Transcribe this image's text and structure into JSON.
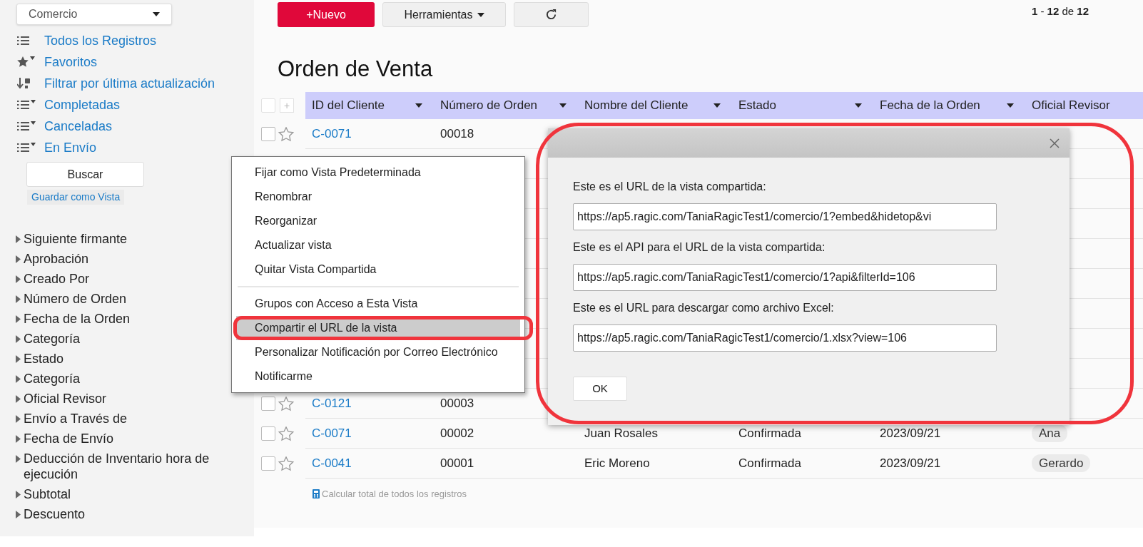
{
  "sidebar": {
    "sheet_select": {
      "value": "Comercio"
    },
    "views": [
      {
        "label": "Todos los Registros",
        "kind": "list"
      },
      {
        "label": "Favoritos",
        "kind": "star"
      },
      {
        "label": "Filtrar por última actualización",
        "kind": "sort"
      },
      {
        "label": "Completadas",
        "kind": "filter"
      },
      {
        "label": "Canceladas",
        "kind": "filter"
      },
      {
        "label": "En Envío",
        "kind": "filter"
      }
    ],
    "search_button": "Buscar",
    "save_view_link": "Guardar como Vista",
    "fields": [
      "Siguiente firmante",
      "Aprobación",
      "Creado Por",
      "Número de Orden",
      "Fecha de la Orden",
      "Categoría",
      "Estado",
      "Categoría",
      "Oficial Revisor",
      "Envío a Través de",
      "Fecha de Envío",
      "Deducción de Inventario hora de ejecución",
      "Subtotal",
      "Descuento"
    ]
  },
  "toolbar": {
    "new_button": "+Nuevo",
    "tools_button": "Herramientas",
    "pagination": "**1** - **12** de **12**"
  },
  "title": "Orden de Venta",
  "table": {
    "columns": [
      "ID del Cliente",
      "Número de Orden",
      "Nombre del Cliente",
      "Estado",
      "Fecha de la Orden",
      "Oficial Revisor"
    ],
    "select_all_checked": false,
    "add_column_icon": "+",
    "rows_top": [
      {
        "checked": false,
        "id": "C-0071",
        "number": "00018"
      }
    ],
    "rows_bottom": [
      {
        "checked": false,
        "id": "C-0121",
        "number": "00003"
      },
      {
        "checked": false,
        "id": "C-0071",
        "number": "00002",
        "name": "Juan Rosales",
        "status": "Confirmada",
        "date": "2023/09/21",
        "reviewer": "Ana"
      },
      {
        "checked": false,
        "id": "C-0041",
        "number": "00001",
        "name": "Eric Moreno",
        "status": "Confirmada",
        "date": "2023/09/21",
        "reviewer": "Gerardo"
      }
    ],
    "total_link": "Calcular total de todos los registros"
  },
  "context_menu": {
    "items": [
      {
        "label": "Fijar como Vista Predeterminada",
        "selected": false,
        "divider_before": false
      },
      {
        "label": "Renombrar",
        "selected": false,
        "divider_before": false
      },
      {
        "label": "Reorganizar",
        "selected": false,
        "divider_before": false
      },
      {
        "label": "Actualizar vista",
        "selected": false,
        "divider_before": false
      },
      {
        "label": "Quitar Vista Compartida",
        "selected": false,
        "divider_before": false
      },
      {
        "label": "Grupos con Acceso a Esta Vista",
        "selected": false,
        "divider_before": true
      },
      {
        "label": "Compartir el URL de la vista",
        "selected": true,
        "divider_before": false
      },
      {
        "label": "Personalizar Notificación por Correo Electrónico",
        "selected": false,
        "divider_before": false
      },
      {
        "label": "Notificarme",
        "selected": false,
        "divider_before": false
      }
    ]
  },
  "dialog": {
    "fields": [
      {
        "label": "Este es el URL de la vista compartida:",
        "value": "https://ap5.ragic.com/TaniaRagicTest1/comercio/1?embed&hidetop&vi"
      },
      {
        "label": "Este es el API para el URL de la vista compartida:",
        "value": "https://ap5.ragic.com/TaniaRagicTest1/comercio/1?api&filterId=106"
      },
      {
        "label": "Este es el URL para descargar como archivo Excel:",
        "value": "https://ap5.ragic.com/TaniaRagicTest1/comercio/1.xlsx?view=106"
      }
    ],
    "ok_button": "OK"
  }
}
